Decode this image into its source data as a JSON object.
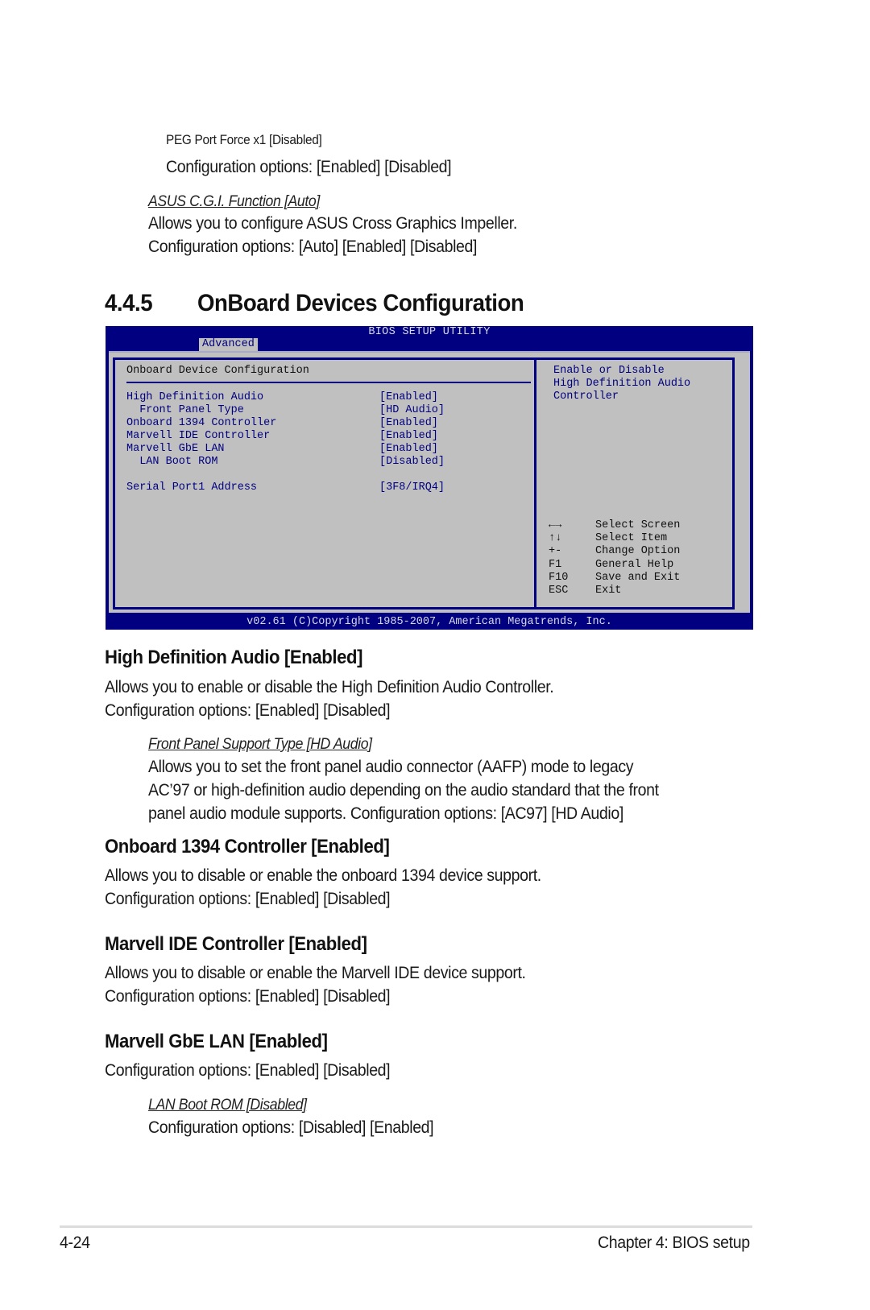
{
  "intro": {
    "peg_item": "PEG Port Force x1 [Disabled]",
    "peg_options": "Configuration options: [Enabled] [Disabled]",
    "cgi_title": "ASUS C.G.I. Function [Auto]",
    "cgi_desc": "Allows you to configure ASUS Cross Graphics Impeller.",
    "cgi_options": "Configuration options: [Auto] [Enabled] [Disabled]"
  },
  "section": {
    "number": "4.4.5",
    "title": "OnBoard Devices Configuration"
  },
  "bios": {
    "title": "BIOS SETUP UTILITY",
    "active_tab": "Advanced",
    "panel_heading": "Onboard Device Configuration",
    "items": [
      {
        "label": "High Definition Audio",
        "value": "[Enabled]"
      },
      {
        "label": "  Front Panel Type",
        "value": "[HD Audio]"
      },
      {
        "label": "Onboard 1394 Controller",
        "value": "[Enabled]"
      },
      {
        "label": "Marvell IDE Controller",
        "value": "[Enabled]"
      },
      {
        "label": "Marvell GbE LAN",
        "value": "[Enabled]"
      },
      {
        "label": "  LAN Boot ROM",
        "value": "[Disabled]"
      },
      {
        "label": "Serial Port1 Address",
        "value": "[3F8/IRQ4]"
      }
    ],
    "help_lines": [
      "Enable or Disable",
      "High Definition Audio",
      "Controller"
    ],
    "keys": [
      {
        "key": "←→",
        "action": "Select Screen",
        "icon": "left-right-arrows-icon"
      },
      {
        "key": "↑↓",
        "action": "Select Item",
        "icon": "up-down-arrows-icon"
      },
      {
        "key": "+-",
        "action": "Change Option"
      },
      {
        "key": "F1",
        "action": "General Help"
      },
      {
        "key": "F10",
        "action": "Save and Exit"
      },
      {
        "key": "ESC",
        "action": "Exit"
      }
    ],
    "footer": "v02.61 (C)Copyright 1985-2007, American Megatrends, Inc.",
    "colors": {
      "background": "#000080",
      "panel": "#c0c0c0",
      "text": "#000080"
    }
  },
  "hda": {
    "title": "High Definition Audio [Enabled]",
    "desc": "Allows you to enable or disable the High Definition Audio Controller.",
    "options": "Configuration options: [Enabled] [Disabled]",
    "sub_title": "Front Panel Support Type [HD Audio]",
    "sub_desc_1": "Allows you to set the front panel audio connector (AAFP) mode to legacy",
    "sub_desc_2": "AC’97 or high-definition audio depending on the audio standard that the front",
    "sub_desc_3": "panel audio module supports. Configuration options: [AC97] [HD Audio]"
  },
  "c1394": {
    "title": "Onboard 1394 Controller [Enabled]",
    "desc": "Allows you to disable or enable the onboard 1394 device support.",
    "options": "Configuration options: [Enabled] [Disabled]"
  },
  "ide": {
    "title": "Marvell IDE Controller [Enabled]",
    "desc": "Allows you to disable or enable the Marvell IDE device support.",
    "options": "Configuration options: [Enabled] [Disabled]"
  },
  "gbe": {
    "title": "Marvell GbE LAN [Enabled]",
    "options": "Configuration options: [Enabled] [Disabled]",
    "sub_title": "LAN Boot ROM [Disabled]",
    "sub_options": "Configuration options: [Disabled] [Enabled]"
  },
  "footer": {
    "page_number": "4-24",
    "chapter": "Chapter 4: BIOS setup"
  }
}
